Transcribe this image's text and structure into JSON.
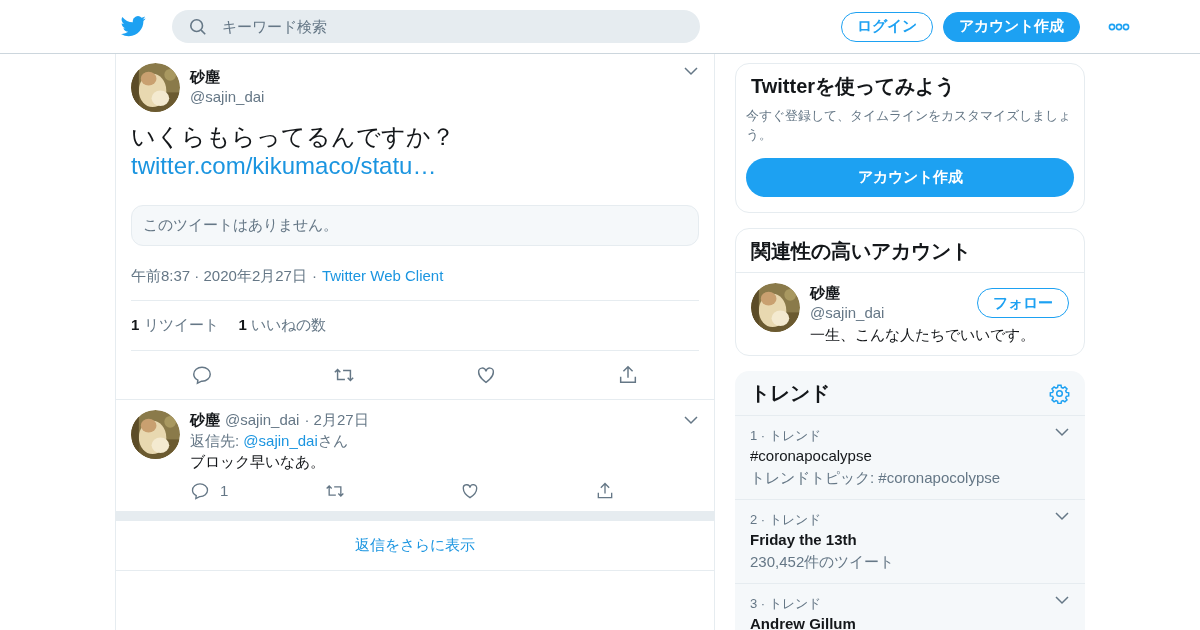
{
  "header": {
    "search": {
      "placeholder": "キーワード検索"
    },
    "buttons": [
      {
        "kind": "outline",
        "label": "ログイン"
      },
      {
        "kind": "filled",
        "label": "アカウント作成"
      }
    ]
  },
  "tweet": {
    "name": "砂塵",
    "handle": "@sajin_dai",
    "text": "いくらもらってるんですか？",
    "link": "twitter.com/kikumaco/statu…",
    "quoted": "このツイートはありません。",
    "time": "午前8:37 · 2020年2月27日",
    "separator": "·",
    "client": "Twitter Web Client",
    "stats": [
      {
        "count": "1",
        "label": "リツイート"
      },
      {
        "count": "1",
        "label": "いいねの数"
      }
    ]
  },
  "replies": [
    {
      "name": "砂塵",
      "handle": "@sajin_dai",
      "date": "· 2月27日",
      "reply_to_label": "返信先: ",
      "reply_to": "@sajin_dai",
      "reply_to_suffix": "さん",
      "text": "ブロック早いなあ。",
      "reply_count": "1"
    }
  ],
  "show_more": "返信をさらに表示",
  "signup_card": {
    "title": "Twitterを使ってみよう",
    "text": "今すぐ登録して、タイムラインをカスタマイズしましょう。",
    "button": "アカウント作成"
  },
  "related": {
    "title": "関連性の高いアカウント",
    "accounts": [
      {
        "name": "砂塵",
        "handle": "@sajin_dai",
        "bio": "一生、こんな人たちでいいです。",
        "button": "フォロー"
      }
    ]
  },
  "trends": {
    "title": "トレンド",
    "items": [
      {
        "rank": "1 · トレンド",
        "name": "#coronapocalypse",
        "kind": "hashtag",
        "meta": "トレンドトピック: #coronapocolypse"
      },
      {
        "rank": "2 · トレンド",
        "name": "Friday the 13th",
        "kind": "topic",
        "meta": "230,452件のツイート"
      },
      {
        "rank": "3 · トレンド",
        "name": "Andrew Gillum",
        "kind": "topic"
      }
    ]
  }
}
